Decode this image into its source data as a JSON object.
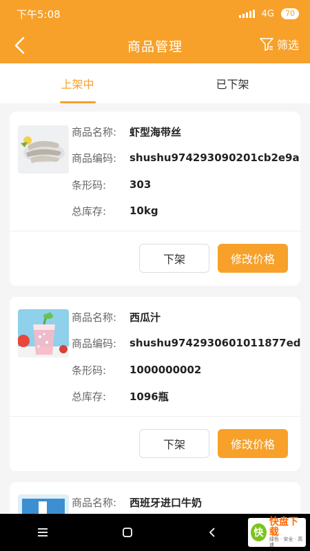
{
  "status": {
    "time": "下午5:08",
    "network": "4G",
    "battery": "70"
  },
  "header": {
    "title": "商品管理",
    "filter_label": "筛选"
  },
  "tabs": [
    {
      "label": "上架中",
      "active": true
    },
    {
      "label": "已下架",
      "active": false
    }
  ],
  "labels": {
    "name": "商品名称:",
    "code": "商品编码:",
    "barcode": "条形码:",
    "stock": "总库存:"
  },
  "products": [
    {
      "name": "虾型海带丝",
      "code": "shushu974293090201cb2e9a",
      "barcode": "303",
      "stock": "10kg",
      "image": "shrimp-image",
      "delist_label": "下架",
      "price_label": "修改价格"
    },
    {
      "name": "西瓜汁",
      "code": "shushu9742930601011877ed",
      "barcode": "1000000002",
      "stock": "1096瓶",
      "image": "juice-image",
      "delist_label": "下架",
      "price_label": "修改价格"
    },
    {
      "name": "西班牙进口牛奶",
      "image": "milk-image"
    }
  ],
  "watermark": {
    "main": "快盘下载",
    "sub": "绿色 · 安全 · 高速",
    "logo": "快"
  },
  "colors": {
    "accent": "#f7a12a",
    "background": "#f5f5f5"
  }
}
